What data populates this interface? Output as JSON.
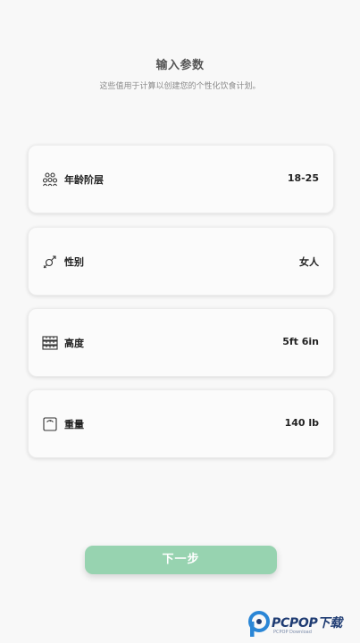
{
  "header": {
    "title": "输入参数",
    "subtitle": "这些值用于计算以创建您的个性化饮食计划。"
  },
  "fields": [
    {
      "label": "年龄阶层",
      "value": "18-25",
      "icon": "people-group-icon"
    },
    {
      "label": "性别",
      "value": "女人",
      "icon": "gender-icon"
    },
    {
      "label": "高度",
      "value": "5ft 6in",
      "icon": "ruler-icon"
    },
    {
      "label": "重量",
      "value": "140 lb",
      "icon": "scale-icon"
    }
  ],
  "next_button": {
    "label": "下一步"
  },
  "colors": {
    "accent": "#97d3b0",
    "background": "#f8f8f8",
    "card": "#fbfbfb"
  },
  "watermark": {
    "text": "PCPOP下载",
    "subtext": "PCPOP Download"
  }
}
